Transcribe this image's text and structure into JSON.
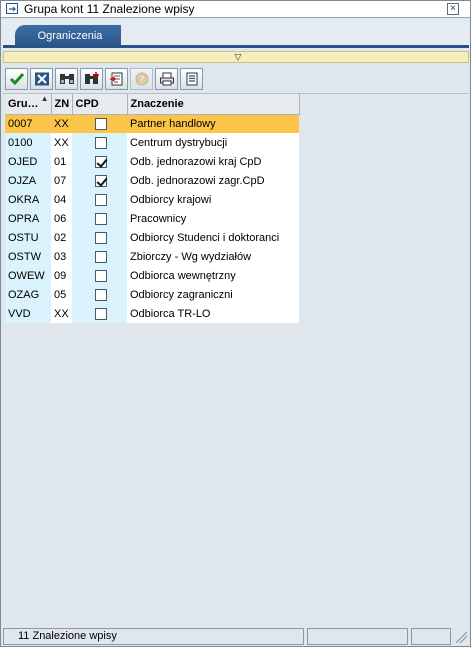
{
  "window": {
    "title": "Grupa kont  11 Znalezione wpisy",
    "close_label": "×"
  },
  "tabs": [
    {
      "label": "Ograniczenia",
      "active": true
    }
  ],
  "toolbar": {
    "buttons": [
      {
        "name": "continue-button",
        "icon": "checkmark-icon",
        "enabled": true
      },
      {
        "name": "cancel-button",
        "icon": "cancel-x-icon",
        "enabled": true
      },
      {
        "name": "find-button",
        "icon": "binoculars-icon",
        "enabled": true
      },
      {
        "name": "find-next-button",
        "icon": "binoculars-plus-icon",
        "enabled": true
      },
      {
        "name": "export-button",
        "icon": "export-icon",
        "enabled": true
      },
      {
        "name": "help-button",
        "icon": "help-icon",
        "enabled": false
      },
      {
        "name": "print-button",
        "icon": "printer-icon",
        "enabled": true
      },
      {
        "name": "settings-button",
        "icon": "list-settings-icon",
        "enabled": true
      }
    ]
  },
  "grid": {
    "columns": [
      "Gru…",
      "ZN",
      "CPD",
      "Znaczenie"
    ],
    "rows": [
      {
        "grupa": "0007",
        "zn": "XX",
        "cpd": false,
        "desc": "Partner handlowy",
        "selected": true
      },
      {
        "grupa": "0100",
        "zn": "XX",
        "cpd": false,
        "desc": "Centrum dystrybucji",
        "selected": false
      },
      {
        "grupa": "OJED",
        "zn": "01",
        "cpd": true,
        "desc": "Odb. jednorazowi kraj CpD",
        "selected": false
      },
      {
        "grupa": "OJZA",
        "zn": "07",
        "cpd": true,
        "desc": "Odb. jednorazowi zagr.CpD",
        "selected": false
      },
      {
        "grupa": "OKRA",
        "zn": "04",
        "cpd": false,
        "desc": "Odbiorcy krajowi",
        "selected": false
      },
      {
        "grupa": "OPRA",
        "zn": "06",
        "cpd": false,
        "desc": "Pracownicy",
        "selected": false
      },
      {
        "grupa": "OSTU",
        "zn": "02",
        "cpd": false,
        "desc": "Odbiorcy Studenci i doktoranci",
        "selected": false
      },
      {
        "grupa": "OSTW",
        "zn": "03",
        "cpd": false,
        "desc": "Zbiorczy - Wg wydziałów",
        "selected": false
      },
      {
        "grupa": "OWEW",
        "zn": "09",
        "cpd": false,
        "desc": "Odbiorca wewnętrzny",
        "selected": false
      },
      {
        "grupa": "OZAG",
        "zn": "05",
        "cpd": false,
        "desc": "Odbiorcy zagraniczni",
        "selected": false
      },
      {
        "grupa": "VVD",
        "zn": "XX",
        "cpd": false,
        "desc": "Odbiorca TR-LO",
        "selected": false
      }
    ]
  },
  "status": {
    "message": "11 Znalezione wpisy"
  },
  "colors": {
    "tab": "#2a5487",
    "selected_row": "#fcc54a",
    "key_column": "#d9f2fb",
    "collapse_bar": "#f4eebc"
  }
}
